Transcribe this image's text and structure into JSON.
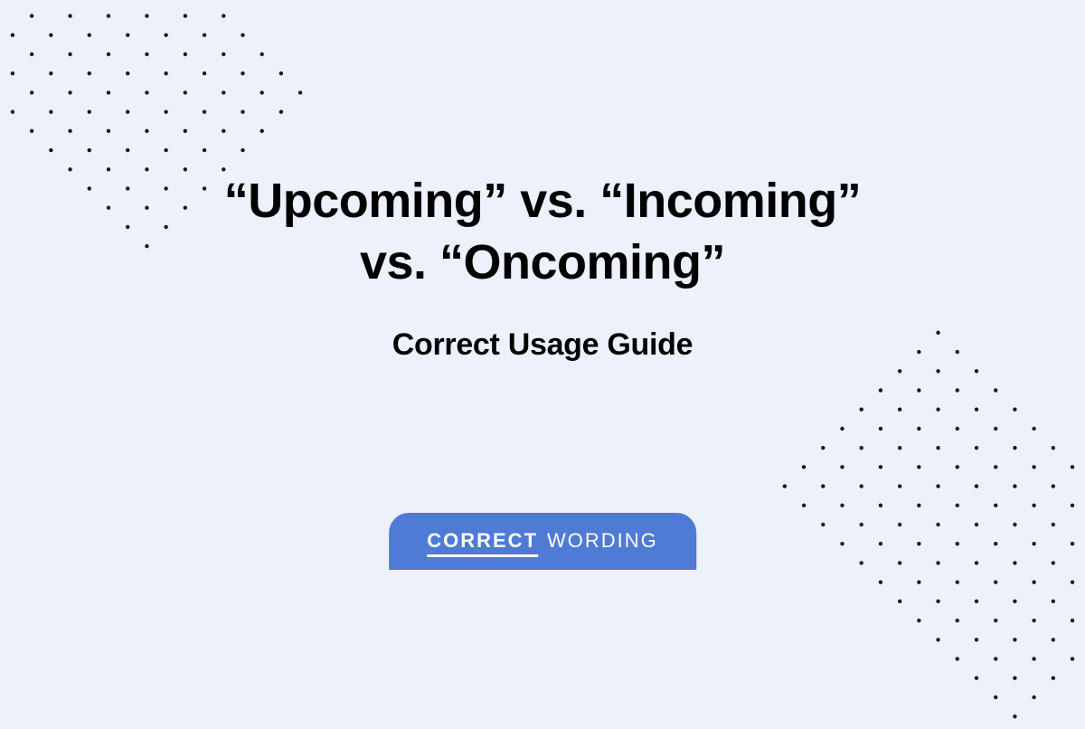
{
  "title_line1": "“Upcoming” vs. “Incoming”",
  "title_line2": "vs. “Oncoming”",
  "subtitle": "Correct Usage Guide",
  "badge": {
    "word1": "CORRECT",
    "word2": "WORDING"
  },
  "colors": {
    "background": "#ecf1fc",
    "badge": "#4f7ad6",
    "text": "#000000",
    "badge_text": "#ffffff"
  }
}
